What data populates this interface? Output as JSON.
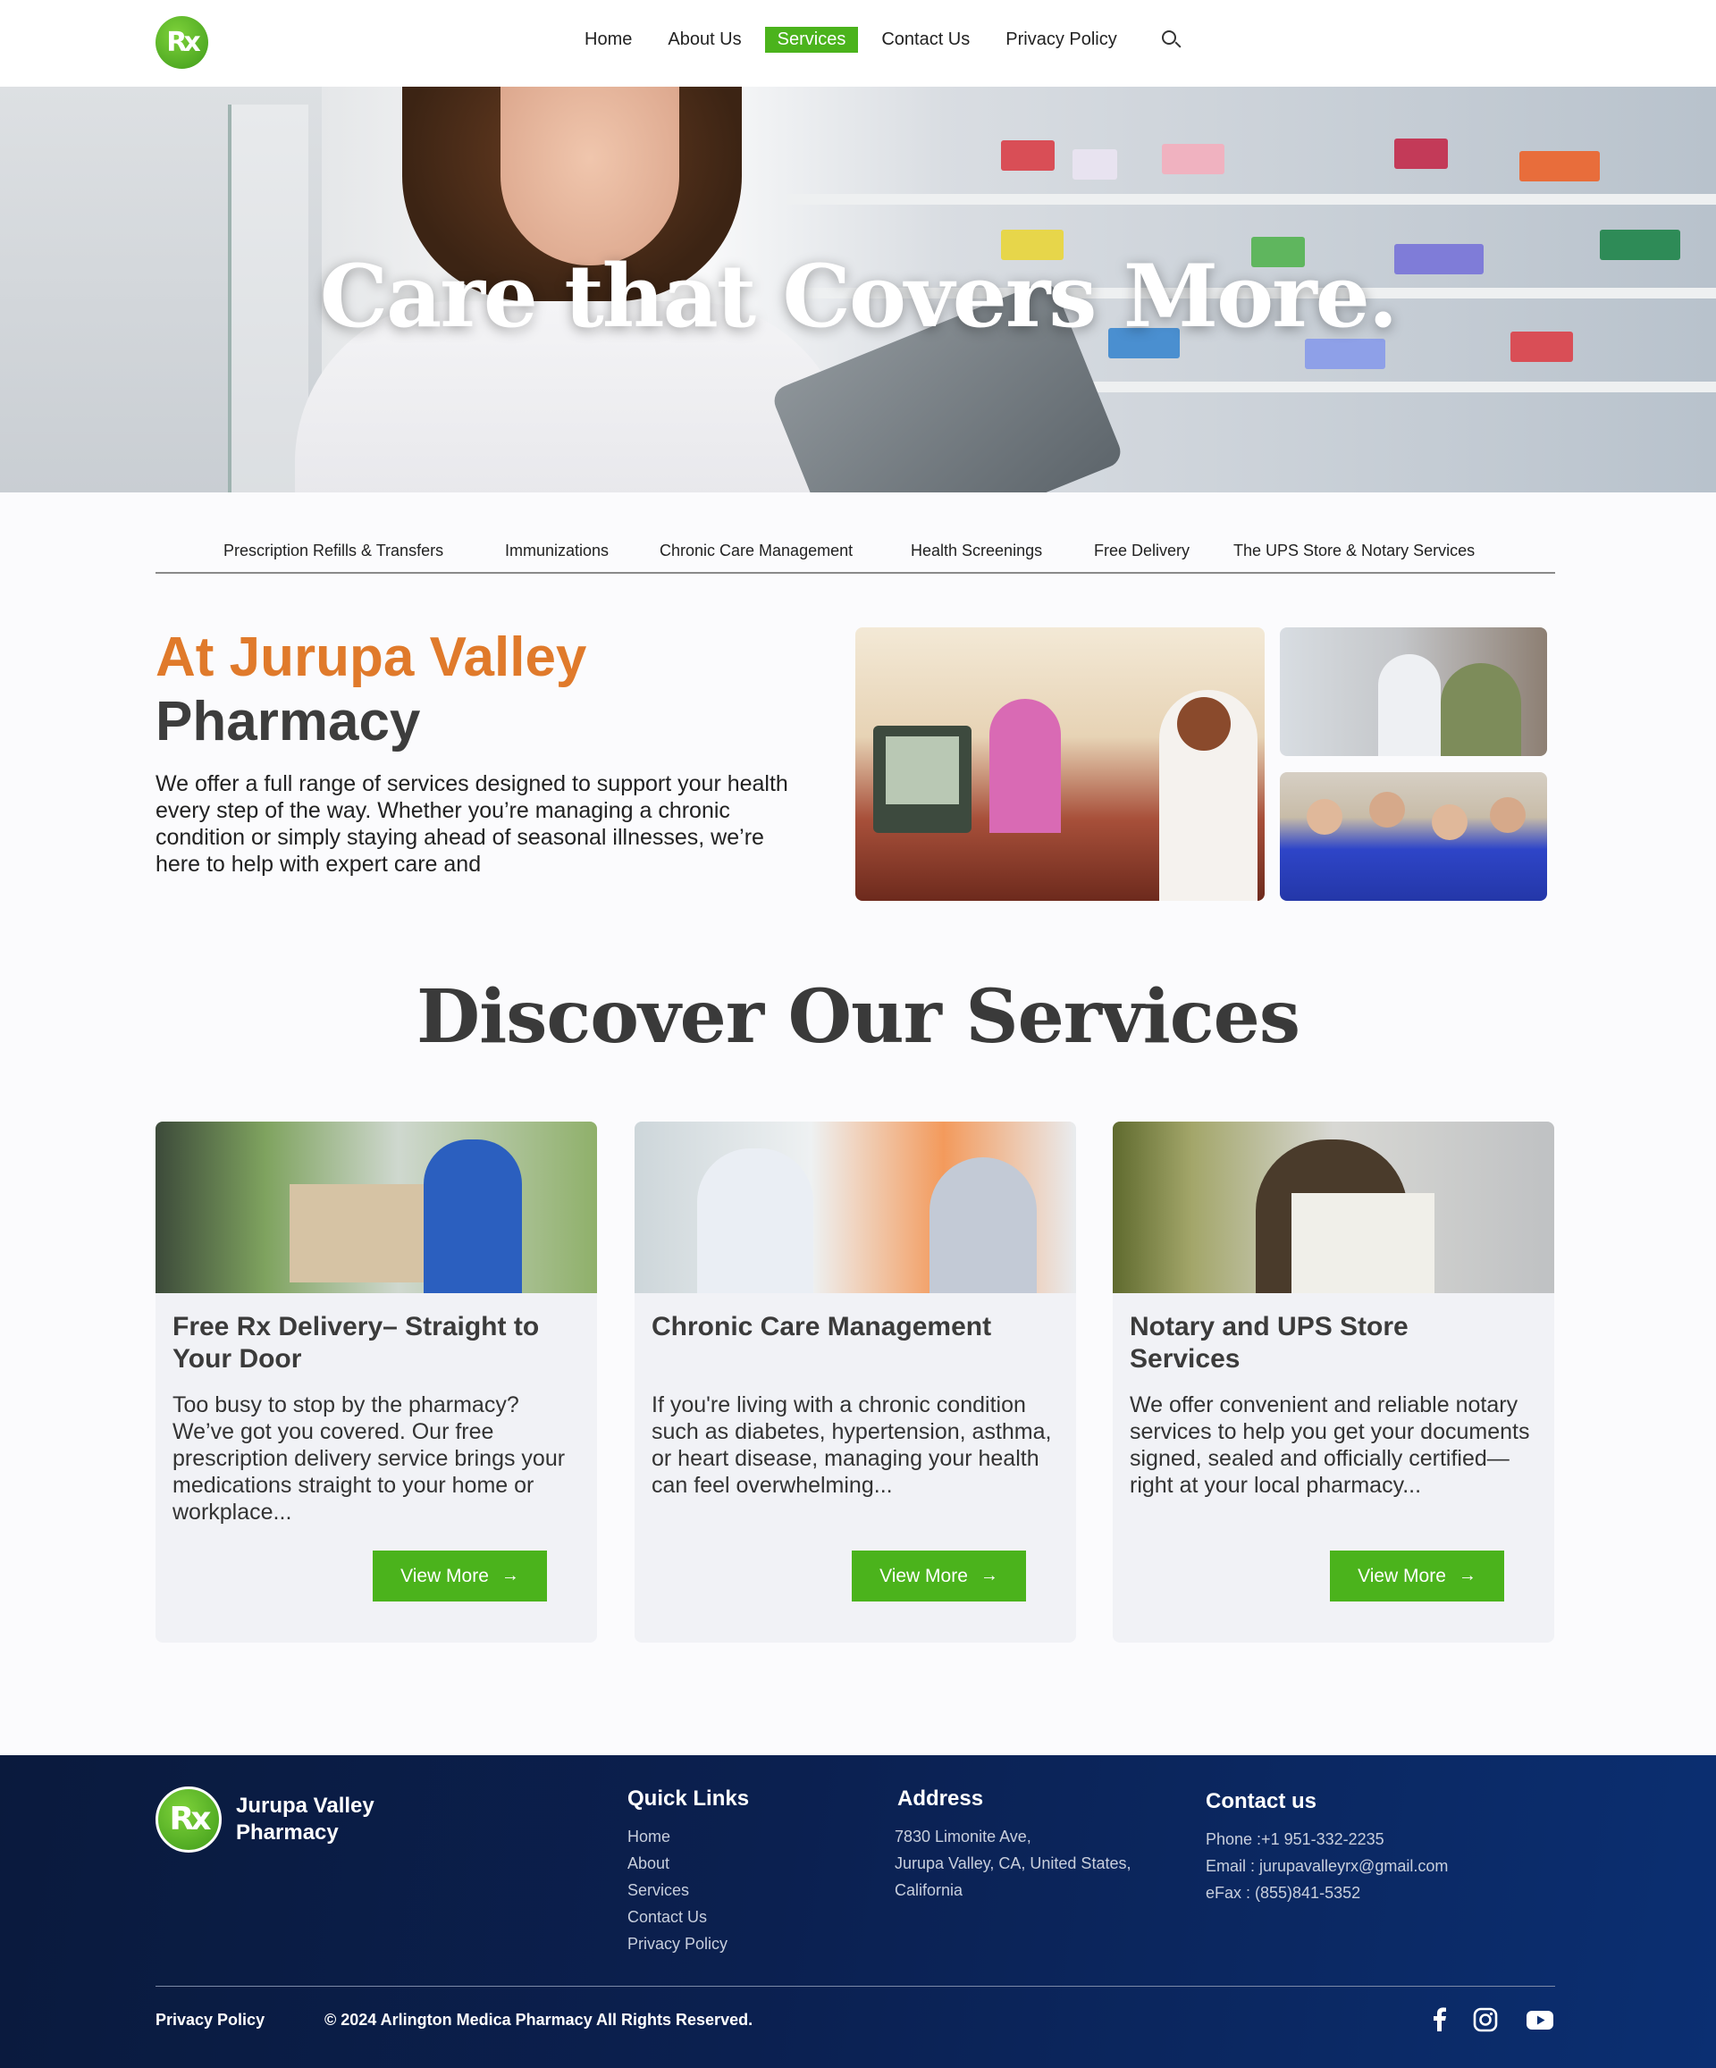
{
  "header": {
    "logo_text": "Rx",
    "nav": [
      "Home",
      "About Us",
      "Services",
      "Contact Us",
      "Privacy Policy"
    ],
    "active": "Services"
  },
  "hero": {
    "title": "Care that Covers More."
  },
  "tabs": [
    "Prescription Refills & Transfers",
    "Immunizations",
    "Chronic Care Management",
    "Health Screenings",
    "Free Delivery",
    "The UPS Store & Notary Services"
  ],
  "intro": {
    "heading_accent": "At Jurupa Valley",
    "heading_rest": "Pharmacy",
    "body": "We offer a full range of services designed to support your health every step of the way. Whether you’re managing a chronic condition or simply staying ahead of seasonal illnesses, we’re here to help with expert care and"
  },
  "services": {
    "title": "Discover Our Services",
    "cards": [
      {
        "title": "Free Rx Delivery– Straight to Your Door",
        "body": "Too busy to stop by the pharmacy? We’ve got you covered. Our free prescription delivery service brings your medications straight to your home or workplace...",
        "button": "View More"
      },
      {
        "title": "Chronic Care Management",
        "body": "If you're living with a chronic condition such as diabetes, hypertension, asthma, or heart disease, managing your health can feel overwhelming...",
        "button": "View More"
      },
      {
        "title": "Notary and UPS Store Services",
        "body": "We offer convenient and reliable notary services to help you get your documents signed, sealed and officially certified—right at your local pharmacy...",
        "button": "View More"
      }
    ]
  },
  "footer": {
    "brand_line1": "Jurupa Valley",
    "brand_line2": "Pharmacy",
    "quick_links_title": "Quick Links",
    "quick_links": [
      "Home",
      "About",
      "Services",
      "Contact Us",
      "Privacy Policy"
    ],
    "address_title": "Address",
    "address_lines": [
      "7830 Limonite Ave,",
      "Jurupa Valley, CA, United States,",
      "California"
    ],
    "contact_title": "Contact us",
    "contact_lines": [
      "Phone :+1 951-332-2235",
      "Email : jurupavalleyrx@gmail.com",
      "eFax : (855)841-5352"
    ],
    "bottom_privacy": "Privacy Policy",
    "copyright": "© 2024 Arlington Medica Pharmacy All Rights Reserved.",
    "social": [
      "facebook-icon",
      "instagram-icon",
      "youtube-icon"
    ]
  },
  "colors": {
    "accent_green": "#4bb31c",
    "accent_orange": "#e07a2b",
    "footer_navy": "#0b2050"
  }
}
